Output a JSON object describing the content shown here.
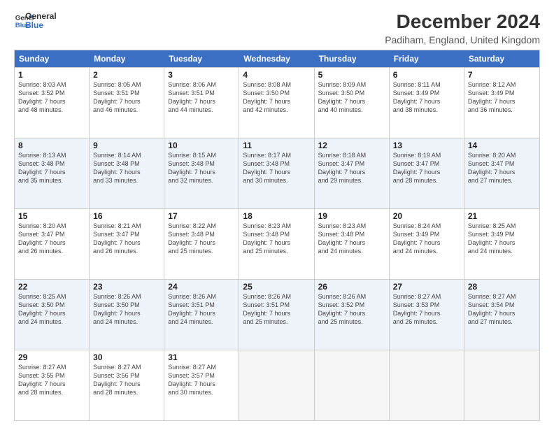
{
  "logo": {
    "line1": "General",
    "line2": "Blue"
  },
  "title": "December 2024",
  "subtitle": "Padiham, England, United Kingdom",
  "weekdays": [
    "Sunday",
    "Monday",
    "Tuesday",
    "Wednesday",
    "Thursday",
    "Friday",
    "Saturday"
  ],
  "rows": [
    [
      {
        "day": "1",
        "info": "Sunrise: 8:03 AM\nSunset: 3:52 PM\nDaylight: 7 hours\nand 48 minutes."
      },
      {
        "day": "2",
        "info": "Sunrise: 8:05 AM\nSunset: 3:51 PM\nDaylight: 7 hours\nand 46 minutes."
      },
      {
        "day": "3",
        "info": "Sunrise: 8:06 AM\nSunset: 3:51 PM\nDaylight: 7 hours\nand 44 minutes."
      },
      {
        "day": "4",
        "info": "Sunrise: 8:08 AM\nSunset: 3:50 PM\nDaylight: 7 hours\nand 42 minutes."
      },
      {
        "day": "5",
        "info": "Sunrise: 8:09 AM\nSunset: 3:50 PM\nDaylight: 7 hours\nand 40 minutes."
      },
      {
        "day": "6",
        "info": "Sunrise: 8:11 AM\nSunset: 3:49 PM\nDaylight: 7 hours\nand 38 minutes."
      },
      {
        "day": "7",
        "info": "Sunrise: 8:12 AM\nSunset: 3:49 PM\nDaylight: 7 hours\nand 36 minutes."
      }
    ],
    [
      {
        "day": "8",
        "info": "Sunrise: 8:13 AM\nSunset: 3:48 PM\nDaylight: 7 hours\nand 35 minutes."
      },
      {
        "day": "9",
        "info": "Sunrise: 8:14 AM\nSunset: 3:48 PM\nDaylight: 7 hours\nand 33 minutes."
      },
      {
        "day": "10",
        "info": "Sunrise: 8:15 AM\nSunset: 3:48 PM\nDaylight: 7 hours\nand 32 minutes."
      },
      {
        "day": "11",
        "info": "Sunrise: 8:17 AM\nSunset: 3:48 PM\nDaylight: 7 hours\nand 30 minutes."
      },
      {
        "day": "12",
        "info": "Sunrise: 8:18 AM\nSunset: 3:47 PM\nDaylight: 7 hours\nand 29 minutes."
      },
      {
        "day": "13",
        "info": "Sunrise: 8:19 AM\nSunset: 3:47 PM\nDaylight: 7 hours\nand 28 minutes."
      },
      {
        "day": "14",
        "info": "Sunrise: 8:20 AM\nSunset: 3:47 PM\nDaylight: 7 hours\nand 27 minutes."
      }
    ],
    [
      {
        "day": "15",
        "info": "Sunrise: 8:20 AM\nSunset: 3:47 PM\nDaylight: 7 hours\nand 26 minutes."
      },
      {
        "day": "16",
        "info": "Sunrise: 8:21 AM\nSunset: 3:47 PM\nDaylight: 7 hours\nand 26 minutes."
      },
      {
        "day": "17",
        "info": "Sunrise: 8:22 AM\nSunset: 3:48 PM\nDaylight: 7 hours\nand 25 minutes."
      },
      {
        "day": "18",
        "info": "Sunrise: 8:23 AM\nSunset: 3:48 PM\nDaylight: 7 hours\nand 25 minutes."
      },
      {
        "day": "19",
        "info": "Sunrise: 8:23 AM\nSunset: 3:48 PM\nDaylight: 7 hours\nand 24 minutes."
      },
      {
        "day": "20",
        "info": "Sunrise: 8:24 AM\nSunset: 3:49 PM\nDaylight: 7 hours\nand 24 minutes."
      },
      {
        "day": "21",
        "info": "Sunrise: 8:25 AM\nSunset: 3:49 PM\nDaylight: 7 hours\nand 24 minutes."
      }
    ],
    [
      {
        "day": "22",
        "info": "Sunrise: 8:25 AM\nSunset: 3:50 PM\nDaylight: 7 hours\nand 24 minutes."
      },
      {
        "day": "23",
        "info": "Sunrise: 8:26 AM\nSunset: 3:50 PM\nDaylight: 7 hours\nand 24 minutes."
      },
      {
        "day": "24",
        "info": "Sunrise: 8:26 AM\nSunset: 3:51 PM\nDaylight: 7 hours\nand 24 minutes."
      },
      {
        "day": "25",
        "info": "Sunrise: 8:26 AM\nSunset: 3:51 PM\nDaylight: 7 hours\nand 25 minutes."
      },
      {
        "day": "26",
        "info": "Sunrise: 8:26 AM\nSunset: 3:52 PM\nDaylight: 7 hours\nand 25 minutes."
      },
      {
        "day": "27",
        "info": "Sunrise: 8:27 AM\nSunset: 3:53 PM\nDaylight: 7 hours\nand 26 minutes."
      },
      {
        "day": "28",
        "info": "Sunrise: 8:27 AM\nSunset: 3:54 PM\nDaylight: 7 hours\nand 27 minutes."
      }
    ],
    [
      {
        "day": "29",
        "info": "Sunrise: 8:27 AM\nSunset: 3:55 PM\nDaylight: 7 hours\nand 28 minutes."
      },
      {
        "day": "30",
        "info": "Sunrise: 8:27 AM\nSunset: 3:56 PM\nDaylight: 7 hours\nand 28 minutes."
      },
      {
        "day": "31",
        "info": "Sunrise: 8:27 AM\nSunset: 3:57 PM\nDaylight: 7 hours\nand 30 minutes."
      },
      {
        "day": "",
        "info": ""
      },
      {
        "day": "",
        "info": ""
      },
      {
        "day": "",
        "info": ""
      },
      {
        "day": "",
        "info": ""
      }
    ]
  ],
  "colors": {
    "header_bg": "#3a6fc4",
    "alt_row_bg": "#eef2f9",
    "empty_bg": "#f5f5f5"
  }
}
